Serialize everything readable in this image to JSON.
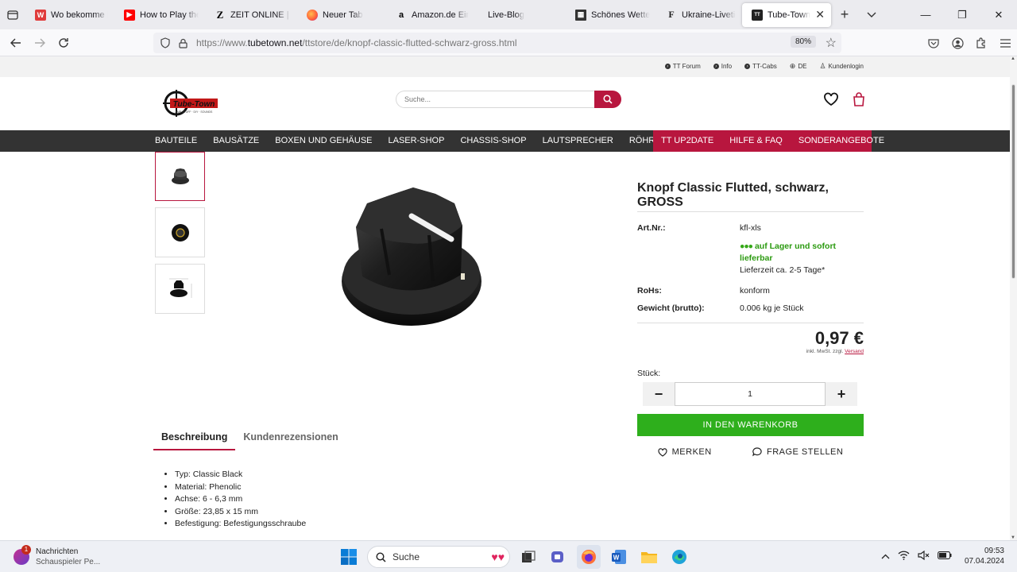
{
  "browser": {
    "tabs": [
      {
        "title": "Wo bekomme ich",
        "favicon": "red-store-icon",
        "color": "#e03b3b"
      },
      {
        "title": "How to Play the C",
        "favicon": "youtube-icon",
        "color": "#ff0000"
      },
      {
        "title": "ZEIT ONLINE | Na",
        "favicon": "zeit-icon",
        "color": "#000000"
      },
      {
        "title": "Neuer Tab",
        "favicon": "firefox-icon",
        "color": "#ff7139"
      },
      {
        "title": "Amazon.de Einka",
        "favicon": "amazon-icon",
        "color": "#ffffff"
      },
      {
        "title": "Live-Blog",
        "favicon": "",
        "color": "#ebebef"
      },
      {
        "title": "Schönes Wetter in",
        "favicon": "news-icon",
        "color": "#333333"
      },
      {
        "title": "Ukraine-Liveticke",
        "favicon": "faz-icon",
        "color": "#ffffff"
      },
      {
        "title": "Tube-Town Sto",
        "favicon": "tubetown-icon",
        "color": "#222222"
      }
    ],
    "url_prefix": "https://www.",
    "url_domain": "tubetown.net",
    "url_path": "/ttstore/de/knopf-classic-flutted-schwarz-gross.html",
    "zoom": "80%"
  },
  "topstrip": {
    "links": [
      "TT Forum",
      "Info",
      "TT-Cabs",
      "DE",
      "Kundenlogin"
    ]
  },
  "header": {
    "search_placeholder": "Suche..."
  },
  "mainnav": {
    "left": [
      "BAUTEILE",
      "BAUSÄTZE",
      "BOXEN UND GEHÄUSE",
      "LASER-SHOP",
      "CHASSIS-SHOP",
      "LAUTSPRECHER",
      "RÖHREN"
    ],
    "right": [
      "TT UP2DATE",
      "HILFE & FAQ",
      "SONDERANGEBOTE"
    ]
  },
  "product": {
    "title": "Knopf Classic Flutted, schwarz, GROSS",
    "art_label": "Art.Nr.:",
    "art_value": "kfl-xls",
    "stock_dots": "●●●",
    "stock_text": "auf Lager und sofort lieferbar",
    "delivery": "Lieferzeit ca. 2-5 Tage*",
    "rohs_label": "RoHs:",
    "rohs_value": "konform",
    "weight_label": "Gewicht (brutto):",
    "weight_value": "0.006 kg je Stück",
    "price": "0,97 €",
    "price_note": "inkl. MwSt. zzgl.",
    "price_link": "Versand",
    "qty_label": "Stück:",
    "qty_value": "1",
    "cart_button": "IN DEN WARENKORB",
    "wishlist": "MERKEN",
    "ask": "FRAGE STELLEN"
  },
  "tabs": [
    "Beschreibung",
    "Kundenrezensionen"
  ],
  "description": [
    "Typ: Classic Black",
    "Material: Phenolic",
    "Achse: 6 - 6,3 mm",
    "Größe: 23,85 x 15 mm",
    "Befestigung: Befestigungsschraube"
  ],
  "taskbar": {
    "notif_title": "Nachrichten",
    "notif_sub": "Schauspieler Pe...",
    "notif_count": "1",
    "search": "Suche",
    "time": "09:53",
    "date": "07.04.2024"
  }
}
